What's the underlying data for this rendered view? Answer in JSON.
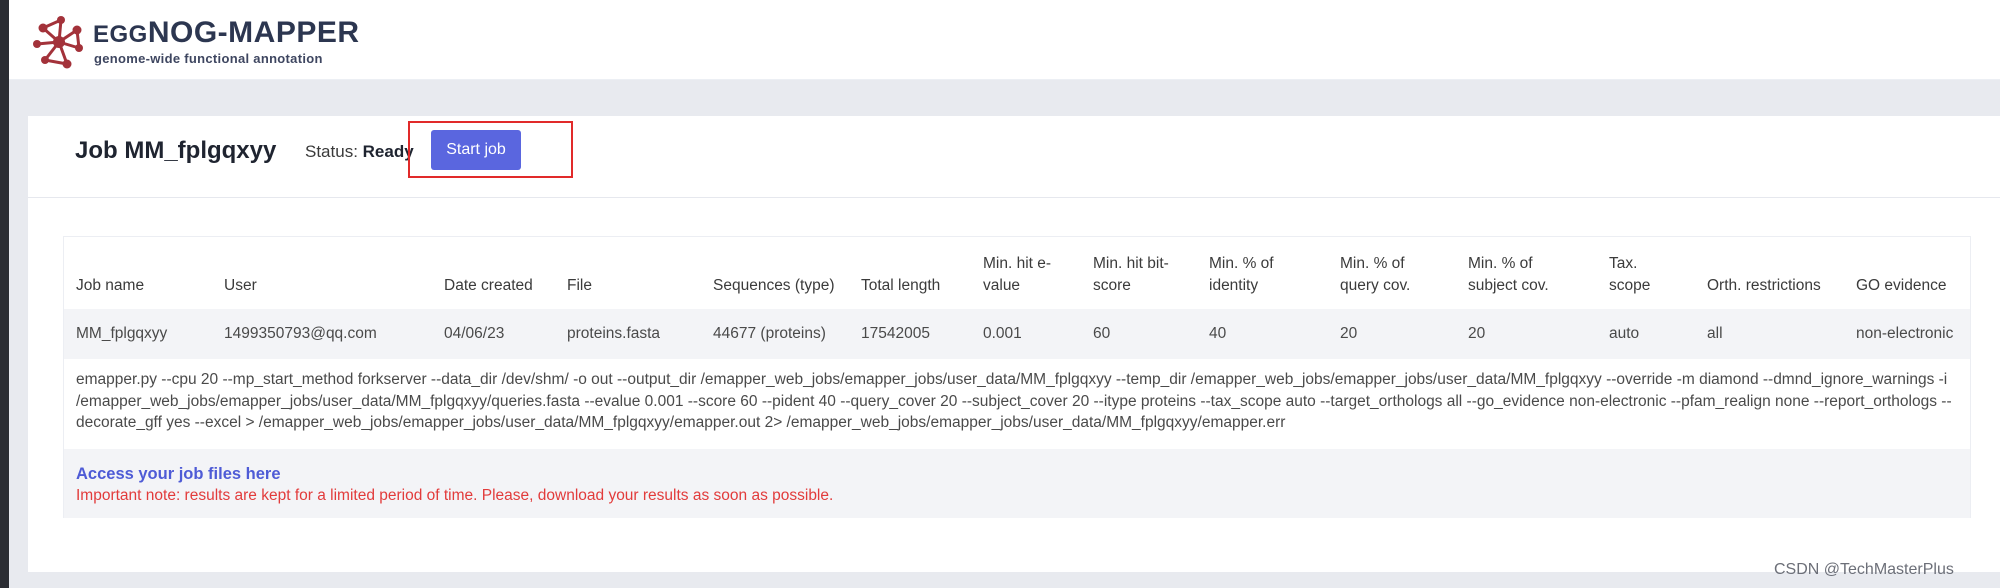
{
  "brand": {
    "title_prefix": "EGG",
    "title_main": "NOG-MAPPER",
    "subtitle": "genome-wide functional annotation"
  },
  "job": {
    "title": "Job MM_fplgqxyy",
    "status_label": "Status:",
    "status_value": "Ready",
    "start_button": "Start job"
  },
  "table": {
    "headers": [
      "Job name",
      "User",
      "Date created",
      "File",
      "Sequences (type)",
      "Total length",
      "Min. hit e-value",
      "Min. hit bit-score",
      "Min. % of identity",
      "Min. % of query cov.",
      "Min. % of subject cov.",
      "Tax. scope",
      "Orth. restrictions",
      "GO evidence"
    ],
    "row": [
      "MM_fplgqxyy",
      "1499350793@qq.com",
      "04/06/23",
      "proteins.fasta",
      "44677 (proteins)",
      "17542005",
      "0.001",
      "60",
      "40",
      "20",
      "20",
      "auto",
      "all",
      "non-electronic"
    ],
    "command": "emapper.py --cpu 20 --mp_start_method forkserver --data_dir /dev/shm/ -o out --output_dir /emapper_web_jobs/emapper_jobs/user_data/MM_fplgqxyy --temp_dir /emapper_web_jobs/emapper_jobs/user_data/MM_fplgqxyy --override -m diamond --dmnd_ignore_warnings -i /emapper_web_jobs/emapper_jobs/user_data/MM_fplgqxyy/queries.fasta --evalue 0.001 --score 60 --pident 40 --query_cover 20 --subject_cover 20 --itype proteins --tax_scope auto --target_orthologs all --go_evidence non-electronic --pfam_realign none --report_orthologs --decorate_gff yes --excel > /emapper_web_jobs/emapper_jobs/user_data/MM_fplgqxyy/emapper.out 2> /emapper_web_jobs/emapper_jobs/user_data/MM_fplgqxyy/emapper.err"
  },
  "access": {
    "link_text": "Access your job files here",
    "note": "Important note: results are kept for a limited period of time. Please, download your results as soon as possible."
  },
  "watermark": "CSDN @TechMasterPlus",
  "colors": {
    "accent": "#5a66df",
    "link": "#4e5bd6",
    "warning": "#e23b3b",
    "highlight_box": "#e12a2a",
    "logo": "#a3323a"
  }
}
